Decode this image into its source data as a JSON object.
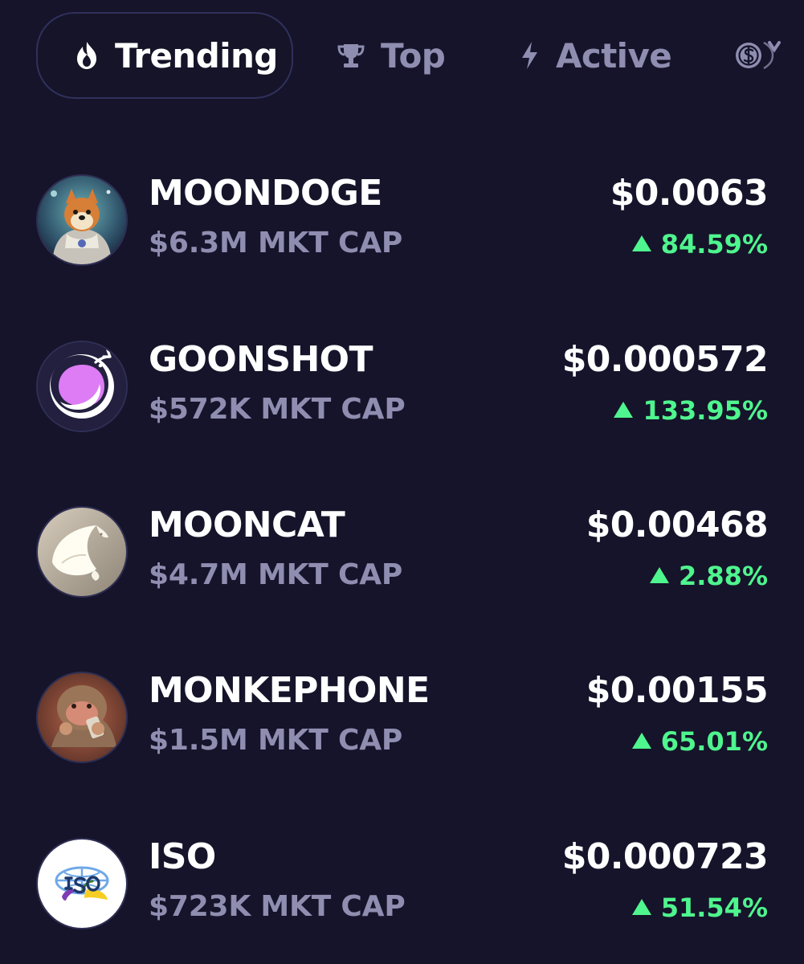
{
  "tabs": [
    {
      "label": "Trending",
      "icon": "flame-icon",
      "selected": true
    },
    {
      "label": "Top",
      "icon": "trophy-icon",
      "selected": false
    },
    {
      "label": "Active",
      "icon": "lightning-icon",
      "selected": false
    },
    {
      "label": "",
      "icon": "coins-icon",
      "selected": false
    }
  ],
  "tokens": [
    {
      "name": "MOONDOGE",
      "market_cap": "$6.3M MKT CAP",
      "price": "$0.0063",
      "change": "84.59%",
      "avatar": "astronaut-shiba-avatar"
    },
    {
      "name": "GOONSHOT",
      "market_cap": "$572K MKT CAP",
      "price": "$0.000572",
      "change": "133.95%",
      "avatar": "goonshot-logo-avatar"
    },
    {
      "name": "MOONCAT",
      "market_cap": "$4.7M MKT CAP",
      "price": "$0.00468",
      "change": "2.88%",
      "avatar": "curled-cat-avatar"
    },
    {
      "name": "MONKEPHONE",
      "market_cap": "$1.5M MKT CAP",
      "price": "$0.00155",
      "change": "65.01%",
      "avatar": "monkey-phone-avatar"
    },
    {
      "name": "ISO",
      "market_cap": "$723K MKT CAP",
      "price": "$0.000723",
      "change": "51.54%",
      "avatar": "iso-logo-avatar"
    }
  ],
  "colors": {
    "background": "#15142a",
    "primary_text": "#ffffff",
    "secondary_text": "#8f8db0",
    "positive_change": "#4ff58e",
    "tab_border": "#30305c"
  }
}
